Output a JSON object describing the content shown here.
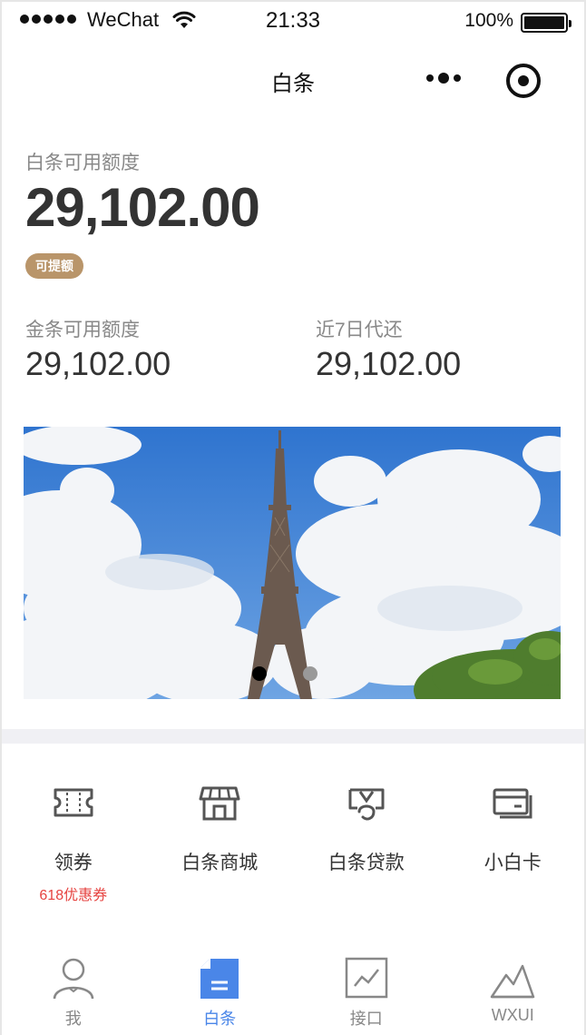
{
  "status_bar": {
    "carrier": "WeChat",
    "time": "21:33",
    "battery": "100%"
  },
  "nav": {
    "title": "白条"
  },
  "credit": {
    "label": "白条可用额度",
    "amount": "29,102.00",
    "tag": "可提额"
  },
  "summary": {
    "left_label": "金条可用额度",
    "left_value": "29,102.00",
    "right_label": "近7日代还",
    "right_value": "29,102.00"
  },
  "banner": {
    "page_count": 2,
    "active_page": 1
  },
  "grid": [
    {
      "label": "领券",
      "sub": "618优惠券",
      "icon": "ticket-icon"
    },
    {
      "label": "白条商城",
      "sub": "",
      "icon": "store-icon"
    },
    {
      "label": "白条贷款",
      "sub": "",
      "icon": "loan-icon"
    },
    {
      "label": "小白卡",
      "sub": "",
      "icon": "card-icon"
    }
  ],
  "tabs": [
    {
      "label": "我",
      "icon": "user-icon",
      "active": false
    },
    {
      "label": "白条",
      "icon": "document-icon",
      "active": true
    },
    {
      "label": "接口",
      "icon": "chart-icon",
      "active": false
    },
    {
      "label": "WXUI",
      "icon": "mountain-icon",
      "active": false
    }
  ],
  "colors": {
    "accent": "#4a86e8",
    "tag_bg": "#b9956a",
    "coupon_red": "#e64340"
  }
}
